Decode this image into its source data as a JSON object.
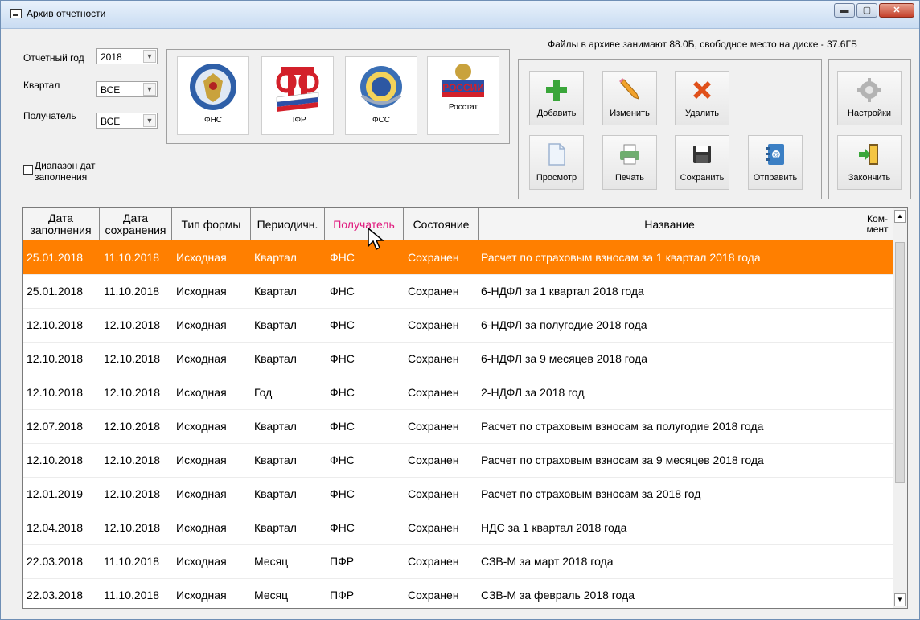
{
  "window": {
    "title": "Архив отчетности",
    "minimize_label": "▬",
    "maximize_label": "▢",
    "close_label": "✕"
  },
  "filters": {
    "year_label": "Отчетный год",
    "year_value": "2018",
    "quarter_label": "Квартал",
    "quarter_value": "ВСЕ",
    "recipient_label": "Получатель",
    "recipient_value": "ВСЕ",
    "date_range_label": "Диапазон дат заполнения"
  },
  "organizations": [
    {
      "name": "ФНС",
      "icon": "fns-emblem-icon"
    },
    {
      "name": "ПФР",
      "icon": "pfr-logo-icon"
    },
    {
      "name": "ФСС",
      "icon": "fss-emblem-icon"
    },
    {
      "name": "Росстат",
      "icon": "rosstat-logo-icon",
      "logo_text": "РОССИИ"
    }
  ],
  "disk_info": "Файлы в архиве занимают 88.0Б,  свободное место на диске - 37.6ГБ",
  "toolbar": {
    "add": "Добавить",
    "edit": "Изменить",
    "delete": "Удалить",
    "settings": "Настройки",
    "view": "Просмотр",
    "print": "Печать",
    "save": "Сохранить",
    "send": "Отправить",
    "finish": "Закончить"
  },
  "colors": {
    "selected_row": "#ff7f00",
    "active_header": "#e0197d"
  },
  "table": {
    "columns": {
      "fill_date": "Дата заполнения",
      "save_date": "Дата сохранения",
      "form_type": "Тип формы",
      "period": "Периодичн.",
      "recipient": "Получатель",
      "status": "Состояние",
      "name": "Название",
      "comment": "Ком-мент"
    },
    "rows": [
      [
        "25.01.2018",
        "11.10.2018",
        "Исходная",
        "Квартал",
        "ФНС",
        "Сохранен",
        "Расчет по страховым взносам за 1 квартал 2018 года"
      ],
      [
        "25.01.2018",
        "11.10.2018",
        "Исходная",
        "Квартал",
        "ФНС",
        "Сохранен",
        "6-НДФЛ за 1 квартал 2018 года"
      ],
      [
        "12.10.2018",
        "12.10.2018",
        "Исходная",
        "Квартал",
        "ФНС",
        "Сохранен",
        "6-НДФЛ за полугодие 2018 года"
      ],
      [
        "12.10.2018",
        "12.10.2018",
        "Исходная",
        "Квартал",
        "ФНС",
        "Сохранен",
        "6-НДФЛ за 9 месяцев 2018 года"
      ],
      [
        "12.10.2018",
        "12.10.2018",
        "Исходная",
        "Год",
        "ФНС",
        "Сохранен",
        "2-НДФЛ за 2018 год"
      ],
      [
        "12.07.2018",
        "12.10.2018",
        "Исходная",
        "Квартал",
        "ФНС",
        "Сохранен",
        "Расчет по страховым взносам за полугодие 2018 года"
      ],
      [
        "12.10.2018",
        "12.10.2018",
        "Исходная",
        "Квартал",
        "ФНС",
        "Сохранен",
        "Расчет по страховым взносам за 9 месяцев 2018 года"
      ],
      [
        "12.01.2019",
        "12.10.2018",
        "Исходная",
        "Квартал",
        "ФНС",
        "Сохранен",
        "Расчет по страховым взносам за 2018 год"
      ],
      [
        "12.04.2018",
        "12.10.2018",
        "Исходная",
        "Квартал",
        "ФНС",
        "Сохранен",
        "НДС за 1 квартал 2018 года"
      ],
      [
        "22.03.2018",
        "11.10.2018",
        "Исходная",
        "Месяц",
        "ПФР",
        "Сохранен",
        "СЗВ-М за март 2018 года"
      ],
      [
        "22.03.2018",
        "11.10.2018",
        "Исходная",
        "Месяц",
        "ПФР",
        "Сохранен",
        "СЗВ-М за февраль 2018 года"
      ]
    ],
    "selected_row": 0
  }
}
